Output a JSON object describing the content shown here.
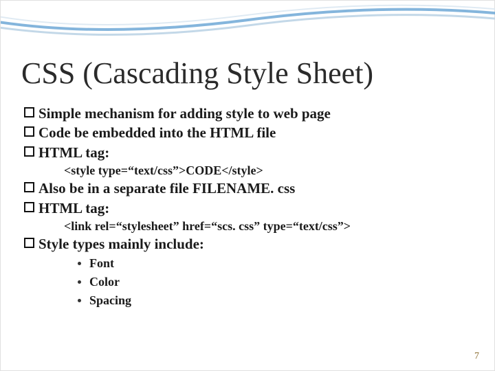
{
  "title": "CSS (Cascading Style Sheet)",
  "bullets": {
    "b1": "Simple mechanism for adding style to web page",
    "b2": "Code be embedded into the HTML file",
    "b3": "HTML tag:",
    "code1": "<style type=“text/css”>CODE</style>",
    "b4": "Also be in a separate file FILENAME. css",
    "b5": "HTML tag:",
    "code2": "<link rel=“stylesheet” href=“scs. css” type=“text/css”>",
    "b6": "Style types mainly include:",
    "sub1": "Font",
    "sub2": "Color",
    "sub3": "Spacing"
  },
  "pageNumber": "7"
}
